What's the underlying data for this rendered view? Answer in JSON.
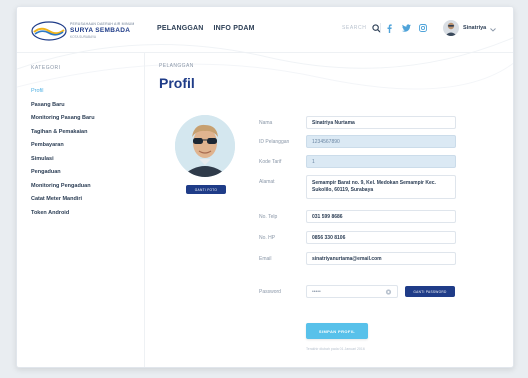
{
  "logo": {
    "small_text": "PERUSAHAAN DAERAH AIR MINUM",
    "main_text": "SURYA SEMBADA",
    "sub_text": "KOTA SURABAYA"
  },
  "nav": {
    "items": [
      {
        "label": "PELANGGAN"
      },
      {
        "label": "INFO PDAM"
      }
    ]
  },
  "search": {
    "label": "SEARCH"
  },
  "user": {
    "name": "Sinatriya"
  },
  "sidebar": {
    "heading": "KATEGORI",
    "items": [
      {
        "label": "Profil",
        "active": true
      },
      {
        "label": "Pasang Baru"
      },
      {
        "label": "Monitoring Pasang Baru"
      },
      {
        "label": "Tagihan & Pemakaian"
      },
      {
        "label": "Pembayaran"
      },
      {
        "label": "Simulasi"
      },
      {
        "label": "Pengaduan"
      },
      {
        "label": "Monitoring Pengaduan"
      },
      {
        "label": "Catat Meter Mandiri"
      },
      {
        "label": "Token Android"
      }
    ]
  },
  "main": {
    "breadcrumb": "PELANGGAN",
    "title": "Profil",
    "photo_button": "GANTI FOTO",
    "fields": [
      {
        "label": "Nama",
        "value": "Sinatriya Nurtama",
        "readonly": false
      },
      {
        "label": "ID Pelanggan",
        "value": "1234567890",
        "readonly": true
      },
      {
        "label": "Kode Tarif",
        "value": "1",
        "readonly": true
      },
      {
        "label": "Alamat",
        "value": "Semampir Barat no. 9, Kel. Medokan Semampir Kec. Sukolilo, 60119, Surabaya",
        "readonly": false
      },
      {
        "label": "No. Telp",
        "value": "031 599 8686",
        "readonly": false
      },
      {
        "label": "No. HP",
        "value": "0856 330 8106",
        "readonly": false
      },
      {
        "label": "Email",
        "value": "sinatriyanurtama@email.com",
        "readonly": false
      }
    ],
    "password": {
      "label": "Password",
      "value": "•••••"
    },
    "password_button": "GANTI PASSWORD",
    "save_button": "SIMPAN PROFIL",
    "note": "Terakhir diubah pada 01 Januari 2016"
  },
  "colors": {
    "brand": "#1f3c88",
    "accent": "#58c1ea",
    "readonly_bg": "#dbe9f4"
  }
}
